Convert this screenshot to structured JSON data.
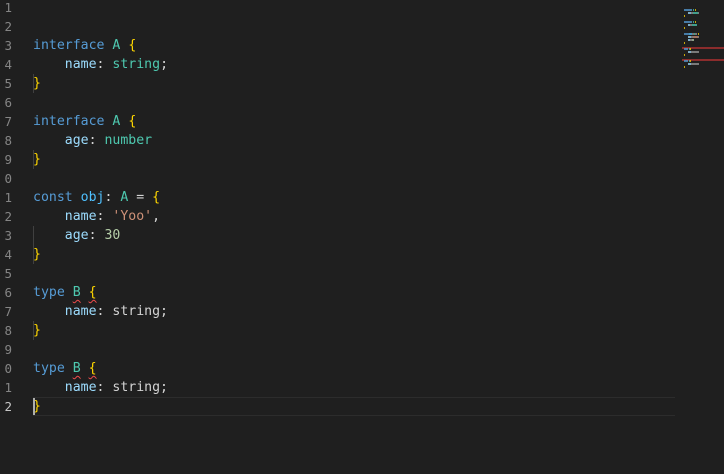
{
  "gutter": {
    "line_numbers": [
      "1",
      "2",
      "3",
      "4",
      "5",
      "6",
      "7",
      "8",
      "9",
      "0",
      "1",
      "2",
      "3",
      "4",
      "5",
      "6",
      "7",
      "8",
      "9",
      "0",
      "1",
      "2"
    ]
  },
  "code": {
    "lines": [
      [],
      [],
      [
        {
          "t": "interface",
          "c": "kw"
        },
        {
          "t": " "
        },
        {
          "t": "A",
          "c": "ty"
        },
        {
          "t": " "
        },
        {
          "t": "{",
          "c": "brace"
        }
      ],
      [
        {
          "t": "    "
        },
        {
          "t": "name",
          "c": "prop"
        },
        {
          "t": ": "
        },
        {
          "t": "string",
          "c": "ty"
        },
        {
          "t": ";"
        }
      ],
      [
        {
          "t": "}",
          "c": "brace"
        }
      ],
      [],
      [
        {
          "t": "interface",
          "c": "kw"
        },
        {
          "t": " "
        },
        {
          "t": "A",
          "c": "ty"
        },
        {
          "t": " "
        },
        {
          "t": "{",
          "c": "brace"
        }
      ],
      [
        {
          "t": "    "
        },
        {
          "t": "age",
          "c": "prop"
        },
        {
          "t": ": "
        },
        {
          "t": "number",
          "c": "ty"
        }
      ],
      [
        {
          "t": "}",
          "c": "brace"
        }
      ],
      [],
      [
        {
          "t": "const",
          "c": "kw"
        },
        {
          "t": " "
        },
        {
          "t": "obj",
          "c": "var"
        },
        {
          "t": ": "
        },
        {
          "t": "A",
          "c": "ty"
        },
        {
          "t": " = "
        },
        {
          "t": "{",
          "c": "brace"
        }
      ],
      [
        {
          "t": "    "
        },
        {
          "t": "name",
          "c": "prop"
        },
        {
          "t": ": "
        },
        {
          "t": "'Yoo'",
          "c": "str"
        },
        {
          "t": ","
        }
      ],
      [
        {
          "t": "    "
        },
        {
          "t": "age",
          "c": "prop"
        },
        {
          "t": ": "
        },
        {
          "t": "30",
          "c": "num"
        }
      ],
      [
        {
          "t": "}",
          "c": "brace"
        }
      ],
      [],
      [
        {
          "t": "type",
          "c": "kw"
        },
        {
          "t": " "
        },
        {
          "t": "B",
          "c": "ty err"
        },
        {
          "t": " "
        },
        {
          "t": "{",
          "c": "brace err"
        }
      ],
      [
        {
          "t": "    "
        },
        {
          "t": "name",
          "c": "prop"
        },
        {
          "t": ": string;"
        }
      ],
      [
        {
          "t": "}",
          "c": "brace"
        }
      ],
      [],
      [
        {
          "t": "type",
          "c": "kw"
        },
        {
          "t": " "
        },
        {
          "t": "B",
          "c": "ty err"
        },
        {
          "t": " "
        },
        {
          "t": "{",
          "c": "brace err"
        }
      ],
      [
        {
          "t": "    "
        },
        {
          "t": "name",
          "c": "prop"
        },
        {
          "t": ": string;"
        }
      ],
      [
        {
          "t": "}",
          "c": "brace"
        }
      ]
    ],
    "current_line": 22
  },
  "colors": {
    "background": "#1f1f1f",
    "keyword": "#569cd6",
    "type": "#4ec9b0",
    "property": "#9cdcfe",
    "string": "#ce9178",
    "number": "#b5cea8",
    "bracket": "#ffd700",
    "error_squiggle": "#f14c4c"
  }
}
